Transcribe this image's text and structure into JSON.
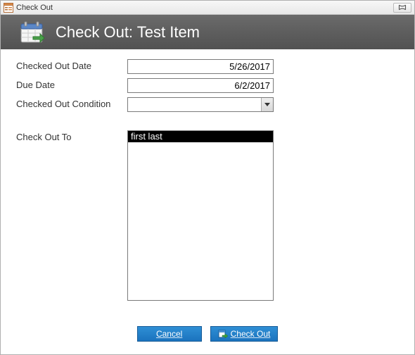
{
  "window": {
    "title": "Check Out"
  },
  "banner": {
    "title": "Check Out: Test Item"
  },
  "form": {
    "checked_out_date_label": "Checked Out Date",
    "checked_out_date_value": "5/26/2017",
    "due_date_label": "Due Date",
    "due_date_value": "6/2/2017",
    "condition_label": "Checked Out Condition",
    "condition_value": "",
    "check_out_to_label": "Check Out To",
    "contact_option": "first last"
  },
  "buttons": {
    "cancel": "Cancel",
    "check_out": "Check Out"
  }
}
